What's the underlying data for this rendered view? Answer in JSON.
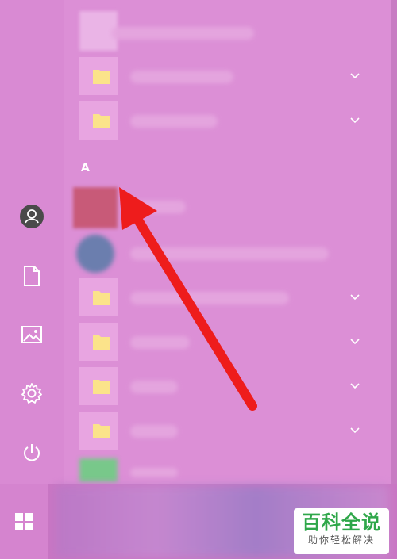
{
  "section_header": "A",
  "rail": {
    "items": [
      {
        "icon": "user-icon"
      },
      {
        "icon": "document-icon"
      },
      {
        "icon": "pictures-icon"
      },
      {
        "icon": "settings-icon"
      },
      {
        "icon": "power-icon"
      }
    ]
  },
  "list": {
    "folders": [
      {
        "icon": "folder-icon",
        "expandable": true
      },
      {
        "icon": "folder-icon",
        "expandable": true
      },
      {
        "icon": "folder-icon",
        "expandable": true
      },
      {
        "icon": "folder-icon",
        "expandable": true
      },
      {
        "icon": "folder-icon",
        "expandable": true
      },
      {
        "icon": "folder-icon",
        "expandable": true
      }
    ]
  },
  "taskbar": {
    "start_icon": "windows-logo-icon"
  },
  "annotation": {
    "color": "#ee1c1c"
  },
  "watermark": {
    "title": "百科全说",
    "subtitle": "助你轻松解决",
    "color": "#2fa74a"
  }
}
